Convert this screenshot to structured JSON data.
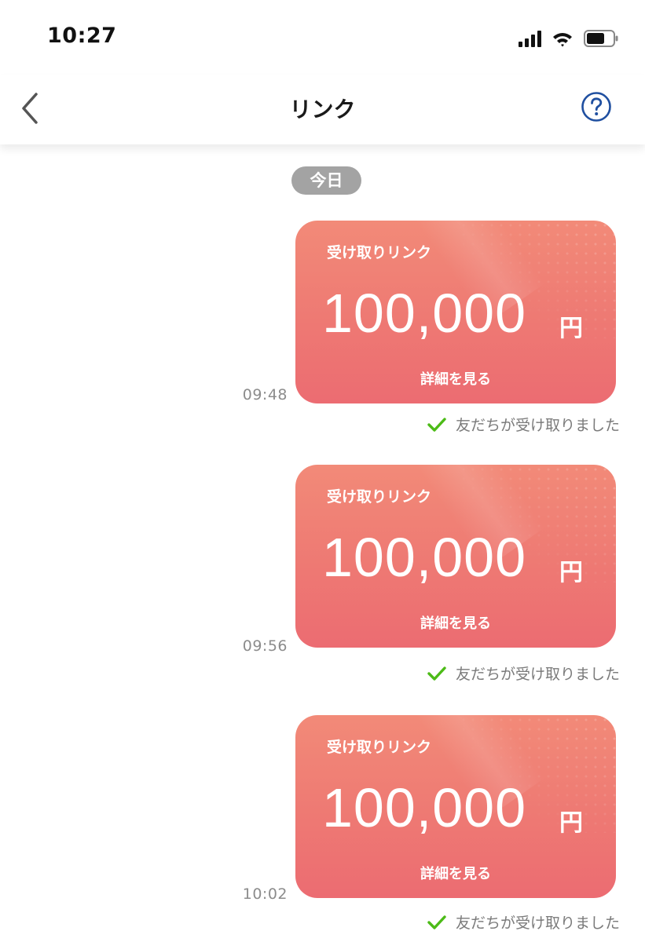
{
  "status_bar": {
    "time": "10:27",
    "icons": [
      "cellular-signal-icon",
      "wifi-icon",
      "battery-icon"
    ]
  },
  "nav": {
    "title": "リンク",
    "back_icon": "chevron-left-icon",
    "help_icon": "question-mark-circle-icon"
  },
  "date_chip": "今日",
  "messages": [
    {
      "time": "09:48",
      "card_label": "受け取りリンク",
      "amount": "100,000",
      "unit": "円",
      "details_link": "詳細を見る",
      "status": "友だちが受け取りました"
    },
    {
      "time": "09:56",
      "card_label": "受け取りリンク",
      "amount": "100,000",
      "unit": "円",
      "details_link": "詳細を見る",
      "status": "友だちが受け取りました"
    },
    {
      "time": "10:02",
      "card_label": "受け取りリンク",
      "amount": "100,000",
      "unit": "円",
      "details_link": "詳細を見る",
      "status": "友だちが受け取りました"
    }
  ],
  "colors": {
    "card_gradient_top": "#f28a78",
    "card_gradient_bottom": "#ec6c72",
    "check_green": "#4cbb17",
    "help_blue": "#1f4fa0",
    "date_chip_gray": "#a3a3a3"
  }
}
